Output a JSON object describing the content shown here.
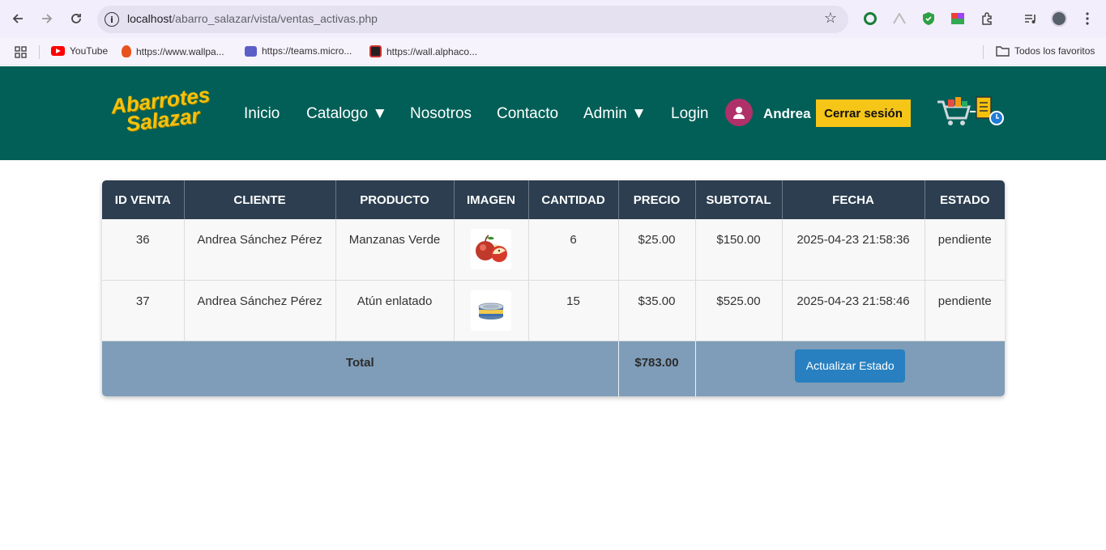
{
  "browser": {
    "url_host": "localhost",
    "url_path": "/abarro_salazar/vista/ventas_activas.php",
    "bookmarks": [
      {
        "label": "YouTube",
        "color": "#ff0000"
      },
      {
        "label": "https://www.wallpa...",
        "color": "#e8531d"
      },
      {
        "label": "https://teams.micro...",
        "color": "#5b5fc7"
      },
      {
        "label": "https://wall.alphaco...",
        "color": "#222222"
      }
    ],
    "all_bookmarks_label": "Todos los favoritos"
  },
  "site": {
    "logo_line1": "Abarrotes",
    "logo_line2": "Salazar",
    "nav": {
      "inicio": "Inicio",
      "catalogo": "Catalogo ▼",
      "nosotros": "Nosotros",
      "contacto": "Contacto",
      "admin": "Admin ▼",
      "login": "Login"
    },
    "username": "Andrea",
    "logout_label": "Cerrar sesión"
  },
  "table": {
    "headers": [
      "ID VENTA",
      "CLIENTE",
      "PRODUCTO",
      "IMAGEN",
      "CANTIDAD",
      "PRECIO",
      "SUBTOTAL",
      "FECHA",
      "ESTADO"
    ],
    "rows": [
      {
        "id": "36",
        "cliente": "Andrea Sánchez Pérez",
        "producto": "Manzanas Verde",
        "imagen": "apple-image",
        "cantidad": "6",
        "precio": "$25.00",
        "subtotal": "$150.00",
        "fecha": "2025-04-23 21:58:36",
        "estado": "pendiente"
      },
      {
        "id": "37",
        "cliente": "Andrea Sánchez Pérez",
        "producto": "Atún enlatado",
        "imagen": "tuna-can-image",
        "cantidad": "15",
        "precio": "$35.00",
        "subtotal": "$525.00",
        "fecha": "2025-04-23 21:58:46",
        "estado": "pendiente"
      }
    ],
    "total_label": "Total",
    "total_value": "$783.00",
    "update_button": "Actualizar Estado"
  },
  "colors": {
    "header_bg": "#015f57",
    "logo": "#f4c20d",
    "table_header": "#2c3e50",
    "footer_row": "#7f9db8",
    "button": "#2880c0",
    "logout": "#f5c518"
  }
}
